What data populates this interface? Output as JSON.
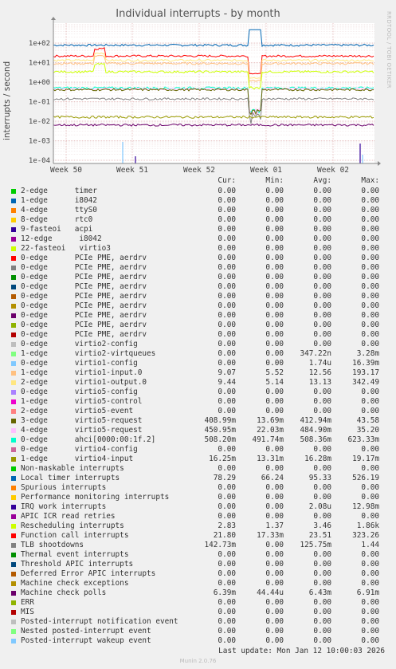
{
  "chart_data": {
    "type": "line",
    "title": "Individual interrupts - by month",
    "ylabel": "interrupts / second",
    "yscale": "log",
    "ylim": [
      7e-05,
      400
    ],
    "yticks": [
      "1e+02",
      "1e+01",
      "1e+00",
      "1e-01",
      "1e-02",
      "1e-03",
      "1e-04"
    ],
    "xticks": [
      "Week 50",
      "Week 51",
      "Week 52",
      "Week 01",
      "Week 02"
    ],
    "side_text": "RRDTOOL / TOBI OETIKER",
    "columns": [
      "Cur:",
      "Min:",
      "Avg:",
      "Max:"
    ],
    "series": [
      {
        "label": "2-edge      timer",
        "color": "#00cc00",
        "cur": "0.00",
        "min": "0.00",
        "avg": "0.00",
        "max": "0.00"
      },
      {
        "label": "1-edge      i8042",
        "color": "#0066b3",
        "cur": "0.00",
        "min": "0.00",
        "avg": "0.00",
        "max": "0.00"
      },
      {
        "label": "4-edge      ttyS0",
        "color": "#ff8000",
        "cur": "0.00",
        "min": "0.00",
        "avg": "0.00",
        "max": "0.00"
      },
      {
        "label": "8-edge      rtc0",
        "color": "#ffcc00",
        "cur": "0.00",
        "min": "0.00",
        "avg": "0.00",
        "max": "0.00"
      },
      {
        "label": "9-fasteoi   acpi",
        "color": "#330099",
        "cur": "0.00",
        "min": "0.00",
        "avg": "0.00",
        "max": "0.00"
      },
      {
        "label": "12-edge      i8042",
        "color": "#990099",
        "cur": "0.00",
        "min": "0.00",
        "avg": "0.00",
        "max": "0.00"
      },
      {
        "label": "22-fasteoi   virtio3",
        "color": "#ccff00",
        "cur": "0.00",
        "min": "0.00",
        "avg": "0.00",
        "max": "0.00"
      },
      {
        "label": "0-edge      PCIe PME, aerdrv",
        "color": "#ff0000",
        "cur": "0.00",
        "min": "0.00",
        "avg": "0.00",
        "max": "0.00"
      },
      {
        "label": "0-edge      PCIe PME, aerdrv",
        "color": "#808080",
        "cur": "0.00",
        "min": "0.00",
        "avg": "0.00",
        "max": "0.00"
      },
      {
        "label": "0-edge      PCIe PME, aerdrv",
        "color": "#008f00",
        "cur": "0.00",
        "min": "0.00",
        "avg": "0.00",
        "max": "0.00"
      },
      {
        "label": "0-edge      PCIe PME, aerdrv",
        "color": "#00487d",
        "cur": "0.00",
        "min": "0.00",
        "avg": "0.00",
        "max": "0.00"
      },
      {
        "label": "0-edge      PCIe PME, aerdrv",
        "color": "#b35a00",
        "cur": "0.00",
        "min": "0.00",
        "avg": "0.00",
        "max": "0.00"
      },
      {
        "label": "0-edge      PCIe PME, aerdrv",
        "color": "#b38f00",
        "cur": "0.00",
        "min": "0.00",
        "avg": "0.00",
        "max": "0.00"
      },
      {
        "label": "0-edge      PCIe PME, aerdrv",
        "color": "#6b006b",
        "cur": "0.00",
        "min": "0.00",
        "avg": "0.00",
        "max": "0.00"
      },
      {
        "label": "0-edge      PCIe PME, aerdrv",
        "color": "#8fb300",
        "cur": "0.00",
        "min": "0.00",
        "avg": "0.00",
        "max": "0.00"
      },
      {
        "label": "0-edge      PCIe PME, aerdrv",
        "color": "#b30000",
        "cur": "0.00",
        "min": "0.00",
        "avg": "0.00",
        "max": "0.00"
      },
      {
        "label": "0-edge      virtio2-config",
        "color": "#bebebe",
        "cur": "0.00",
        "min": "0.00",
        "avg": "0.00",
        "max": "0.00"
      },
      {
        "label": "1-edge      virtio2-virtqueues",
        "color": "#80ff80",
        "cur": "0.00",
        "min": "0.00",
        "avg": "347.22n",
        "max": "3.28m"
      },
      {
        "label": "0-edge      virtio1-config",
        "color": "#80c9ff",
        "cur": "0.00",
        "min": "0.00",
        "avg": "1.74u",
        "max": "16.39m"
      },
      {
        "label": "1-edge      virtio1-input.0",
        "color": "#ffc080",
        "cur": "9.07",
        "min": "5.52",
        "avg": "12.56",
        "max": "193.17"
      },
      {
        "label": "2-edge      virtio1-output.0",
        "color": "#ffe680",
        "cur": "9.44",
        "min": "5.14",
        "avg": "13.13",
        "max": "342.49"
      },
      {
        "label": "0-edge      virtio5-config",
        "color": "#aa80ff",
        "cur": "0.00",
        "min": "0.00",
        "avg": "0.00",
        "max": "0.00"
      },
      {
        "label": "1-edge      virtio5-control",
        "color": "#ee00cc",
        "cur": "0.00",
        "min": "0.00",
        "avg": "0.00",
        "max": "0.00"
      },
      {
        "label": "2-edge      virtio5-event",
        "color": "#ff8080",
        "cur": "0.00",
        "min": "0.00",
        "avg": "0.00",
        "max": "0.00"
      },
      {
        "label": "3-edge      virtio5-request",
        "color": "#666600",
        "cur": "408.99m",
        "min": "13.69m",
        "avg": "412.94m",
        "max": "43.58"
      },
      {
        "label": "4-edge      virtio5-request",
        "color": "#ffbfff",
        "cur": "450.95m",
        "min": "22.03m",
        "avg": "484.90m",
        "max": "35.20"
      },
      {
        "label": "0-edge      ahci[0000:00:1f.2]",
        "color": "#00ffcc",
        "cur": "508.20m",
        "min": "491.74m",
        "avg": "508.36m",
        "max": "623.33m"
      },
      {
        "label": "0-edge      virtio4-config",
        "color": "#cc6699",
        "cur": "0.00",
        "min": "0.00",
        "avg": "0.00",
        "max": "0.00"
      },
      {
        "label": "1-edge      virtio4-input",
        "color": "#999900",
        "cur": "16.25m",
        "min": "13.31m",
        "avg": "16.28m",
        "max": "19.17m"
      },
      {
        "label": "Non-maskable interrupts",
        "color": "#00cc00",
        "cur": "0.00",
        "min": "0.00",
        "avg": "0.00",
        "max": "0.00"
      },
      {
        "label": "Local timer interrupts",
        "color": "#0066b3",
        "cur": "78.29",
        "min": "66.24",
        "avg": "95.33",
        "max": "526.19"
      },
      {
        "label": "Spurious interrupts",
        "color": "#ff8000",
        "cur": "0.00",
        "min": "0.00",
        "avg": "0.00",
        "max": "0.00"
      },
      {
        "label": "Performance monitoring interrupts",
        "color": "#ffcc00",
        "cur": "0.00",
        "min": "0.00",
        "avg": "0.00",
        "max": "0.00"
      },
      {
        "label": "IRQ work interrupts",
        "color": "#330099",
        "cur": "0.00",
        "min": "0.00",
        "avg": "2.08u",
        "max": "12.98m"
      },
      {
        "label": "APIC ICR read retries",
        "color": "#990099",
        "cur": "0.00",
        "min": "0.00",
        "avg": "0.00",
        "max": "0.00"
      },
      {
        "label": "Rescheduling interrupts",
        "color": "#ccff00",
        "cur": "2.83",
        "min": "1.37",
        "avg": "3.46",
        "max": "1.86k"
      },
      {
        "label": "Function call interrupts",
        "color": "#ff0000",
        "cur": "21.80",
        "min": "17.33m",
        "avg": "23.51",
        "max": "323.26"
      },
      {
        "label": "TLB shootdowns",
        "color": "#808080",
        "cur": "142.73m",
        "min": "0.00",
        "avg": "125.75m",
        "max": "1.44"
      },
      {
        "label": "Thermal event interrupts",
        "color": "#008f00",
        "cur": "0.00",
        "min": "0.00",
        "avg": "0.00",
        "max": "0.00"
      },
      {
        "label": "Threshold APIC interrupts",
        "color": "#00487d",
        "cur": "0.00",
        "min": "0.00",
        "avg": "0.00",
        "max": "0.00"
      },
      {
        "label": "Deferred Error APIC interrupts",
        "color": "#b35a00",
        "cur": "0.00",
        "min": "0.00",
        "avg": "0.00",
        "max": "0.00"
      },
      {
        "label": "Machine check exceptions",
        "color": "#b38f00",
        "cur": "0.00",
        "min": "0.00",
        "avg": "0.00",
        "max": "0.00"
      },
      {
        "label": "Machine check polls",
        "color": "#6b006b",
        "cur": "6.39m",
        "min": "44.44u",
        "avg": "6.43m",
        "max": "6.91m"
      },
      {
        "label": "ERR",
        "color": "#8fb300",
        "cur": "0.00",
        "min": "0.00",
        "avg": "0.00",
        "max": "0.00"
      },
      {
        "label": "MIS",
        "color": "#b30000",
        "cur": "0.00",
        "min": "0.00",
        "avg": "0.00",
        "max": "0.00"
      },
      {
        "label": "Posted-interrupt notification event",
        "color": "#bebebe",
        "cur": "0.00",
        "min": "0.00",
        "avg": "0.00",
        "max": "0.00"
      },
      {
        "label": "Nested posted-interrupt event",
        "color": "#80ff80",
        "cur": "0.00",
        "min": "0.00",
        "avg": "0.00",
        "max": "0.00"
      },
      {
        "label": "Posted-interrupt wakeup event",
        "color": "#80c9ff",
        "cur": "0.00",
        "min": "0.00",
        "avg": "0.00",
        "max": "0.00"
      }
    ],
    "lines": [
      {
        "name": "Local timer interrupts",
        "color": "#0066b3",
        "level": 78
      },
      {
        "name": "Function call interrupts",
        "color": "#ff0000",
        "level": 21.8
      },
      {
        "name": "virtio1-output.0",
        "color": "#ffe680",
        "level": 13
      },
      {
        "name": "virtio1-input.0",
        "color": "#ffc080",
        "level": 9
      },
      {
        "name": "Rescheduling interrupts",
        "color": "#ccff00",
        "level": 3.4
      },
      {
        "name": "ahci[0000:00:1f.2]",
        "color": "#00ffcc",
        "level": 0.508
      },
      {
        "name": "virtio5-request 4",
        "color": "#ffbfff",
        "level": 0.45
      },
      {
        "name": "virtio5-request 3",
        "color": "#666600",
        "level": 0.41
      },
      {
        "name": "TLB shootdowns",
        "color": "#808080",
        "level": 0.14
      },
      {
        "name": "virtio4-input",
        "color": "#999900",
        "level": 0.0163
      },
      {
        "name": "Machine check polls",
        "color": "#6b006b",
        "level": 0.0064
      }
    ],
    "last_update": "Last update: Mon Jan 12 10:00:03 2026",
    "footer": "Munin 2.0.76"
  }
}
